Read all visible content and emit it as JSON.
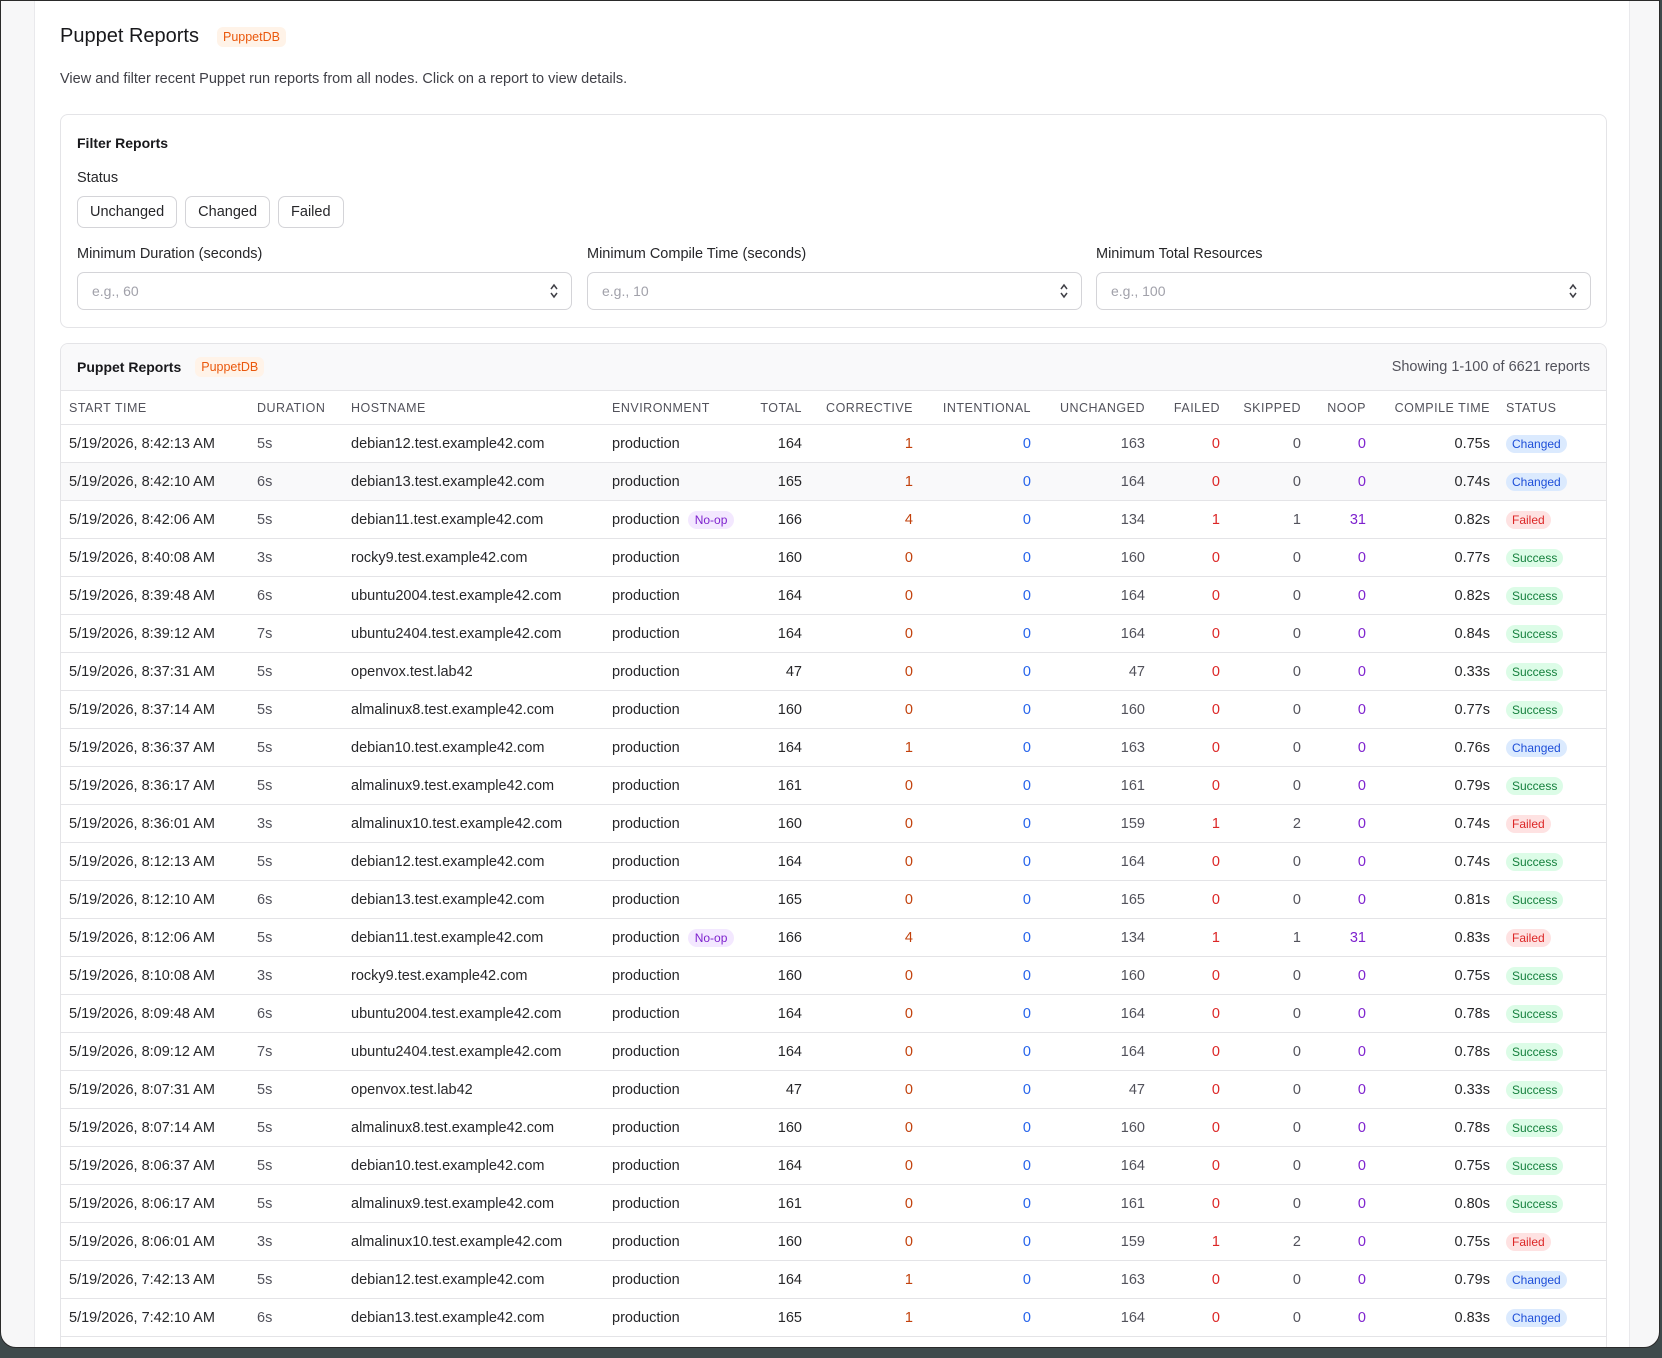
{
  "page": {
    "title": "Puppet Reports",
    "badge": "PuppetDB",
    "description": "View and filter recent Puppet run reports from all nodes. Click on a report to view details."
  },
  "filters": {
    "title": "Filter Reports",
    "status_label": "Status",
    "status_options": [
      "Unchanged",
      "Changed",
      "Failed"
    ],
    "min_duration": {
      "label": "Minimum Duration (seconds)",
      "placeholder": "e.g., 60"
    },
    "min_compile": {
      "label": "Minimum Compile Time (seconds)",
      "placeholder": "e.g., 10"
    },
    "min_resources": {
      "label": "Minimum Total Resources",
      "placeholder": "e.g., 100"
    }
  },
  "table": {
    "title": "Puppet Reports",
    "badge": "PuppetDB",
    "count_text": "Showing 1-100 of 6621 reports",
    "columns": [
      "START TIME",
      "DURATION",
      "HOSTNAME",
      "ENVIRONMENT",
      "TOTAL",
      "CORRECTIVE",
      "INTENTIONAL",
      "UNCHANGED",
      "FAILED",
      "SKIPPED",
      "NOOP",
      "COMPILE TIME",
      "STATUS"
    ],
    "rows": [
      {
        "start": "5/19/2026, 8:42:13 AM",
        "duration": "5s",
        "host": "debian12.test.example42.com",
        "env": "production",
        "noop_tag": "",
        "total": "164",
        "corrective": "1",
        "intentional": "0",
        "unchanged": "163",
        "failed": "0",
        "skipped": "0",
        "noop": "0",
        "compile": "0.75s",
        "status": "Changed"
      },
      {
        "start": "5/19/2026, 8:42:10 AM",
        "duration": "6s",
        "host": "debian13.test.example42.com",
        "env": "production",
        "noop_tag": "",
        "total": "165",
        "corrective": "1",
        "intentional": "0",
        "unchanged": "164",
        "failed": "0",
        "skipped": "0",
        "noop": "0",
        "compile": "0.74s",
        "status": "Changed"
      },
      {
        "start": "5/19/2026, 8:42:06 AM",
        "duration": "5s",
        "host": "debian11.test.example42.com",
        "env": "production",
        "noop_tag": "No-op",
        "total": "166",
        "corrective": "4",
        "intentional": "0",
        "unchanged": "134",
        "failed": "1",
        "skipped": "1",
        "noop": "31",
        "compile": "0.82s",
        "status": "Failed"
      },
      {
        "start": "5/19/2026, 8:40:08 AM",
        "duration": "3s",
        "host": "rocky9.test.example42.com",
        "env": "production",
        "noop_tag": "",
        "total": "160",
        "corrective": "0",
        "intentional": "0",
        "unchanged": "160",
        "failed": "0",
        "skipped": "0",
        "noop": "0",
        "compile": "0.77s",
        "status": "Success"
      },
      {
        "start": "5/19/2026, 8:39:48 AM",
        "duration": "6s",
        "host": "ubuntu2004.test.example42.com",
        "env": "production",
        "noop_tag": "",
        "total": "164",
        "corrective": "0",
        "intentional": "0",
        "unchanged": "164",
        "failed": "0",
        "skipped": "0",
        "noop": "0",
        "compile": "0.82s",
        "status": "Success"
      },
      {
        "start": "5/19/2026, 8:39:12 AM",
        "duration": "7s",
        "host": "ubuntu2404.test.example42.com",
        "env": "production",
        "noop_tag": "",
        "total": "164",
        "corrective": "0",
        "intentional": "0",
        "unchanged": "164",
        "failed": "0",
        "skipped": "0",
        "noop": "0",
        "compile": "0.84s",
        "status": "Success"
      },
      {
        "start": "5/19/2026, 8:37:31 AM",
        "duration": "5s",
        "host": "openvox.test.lab42",
        "env": "production",
        "noop_tag": "",
        "total": "47",
        "corrective": "0",
        "intentional": "0",
        "unchanged": "47",
        "failed": "0",
        "skipped": "0",
        "noop": "0",
        "compile": "0.33s",
        "status": "Success"
      },
      {
        "start": "5/19/2026, 8:37:14 AM",
        "duration": "5s",
        "host": "almalinux8.test.example42.com",
        "env": "production",
        "noop_tag": "",
        "total": "160",
        "corrective": "0",
        "intentional": "0",
        "unchanged": "160",
        "failed": "0",
        "skipped": "0",
        "noop": "0",
        "compile": "0.77s",
        "status": "Success"
      },
      {
        "start": "5/19/2026, 8:36:37 AM",
        "duration": "5s",
        "host": "debian10.test.example42.com",
        "env": "production",
        "noop_tag": "",
        "total": "164",
        "corrective": "1",
        "intentional": "0",
        "unchanged": "163",
        "failed": "0",
        "skipped": "0",
        "noop": "0",
        "compile": "0.76s",
        "status": "Changed"
      },
      {
        "start": "5/19/2026, 8:36:17 AM",
        "duration": "5s",
        "host": "almalinux9.test.example42.com",
        "env": "production",
        "noop_tag": "",
        "total": "161",
        "corrective": "0",
        "intentional": "0",
        "unchanged": "161",
        "failed": "0",
        "skipped": "0",
        "noop": "0",
        "compile": "0.79s",
        "status": "Success"
      },
      {
        "start": "5/19/2026, 8:36:01 AM",
        "duration": "3s",
        "host": "almalinux10.test.example42.com",
        "env": "production",
        "noop_tag": "",
        "total": "160",
        "corrective": "0",
        "intentional": "0",
        "unchanged": "159",
        "failed": "1",
        "skipped": "2",
        "noop": "0",
        "compile": "0.74s",
        "status": "Failed"
      },
      {
        "start": "5/19/2026, 8:12:13 AM",
        "duration": "5s",
        "host": "debian12.test.example42.com",
        "env": "production",
        "noop_tag": "",
        "total": "164",
        "corrective": "0",
        "intentional": "0",
        "unchanged": "164",
        "failed": "0",
        "skipped": "0",
        "noop": "0",
        "compile": "0.74s",
        "status": "Success"
      },
      {
        "start": "5/19/2026, 8:12:10 AM",
        "duration": "6s",
        "host": "debian13.test.example42.com",
        "env": "production",
        "noop_tag": "",
        "total": "165",
        "corrective": "0",
        "intentional": "0",
        "unchanged": "165",
        "failed": "0",
        "skipped": "0",
        "noop": "0",
        "compile": "0.81s",
        "status": "Success"
      },
      {
        "start": "5/19/2026, 8:12:06 AM",
        "duration": "5s",
        "host": "debian11.test.example42.com",
        "env": "production",
        "noop_tag": "No-op",
        "total": "166",
        "corrective": "4",
        "intentional": "0",
        "unchanged": "134",
        "failed": "1",
        "skipped": "1",
        "noop": "31",
        "compile": "0.83s",
        "status": "Failed"
      },
      {
        "start": "5/19/2026, 8:10:08 AM",
        "duration": "3s",
        "host": "rocky9.test.example42.com",
        "env": "production",
        "noop_tag": "",
        "total": "160",
        "corrective": "0",
        "intentional": "0",
        "unchanged": "160",
        "failed": "0",
        "skipped": "0",
        "noop": "0",
        "compile": "0.75s",
        "status": "Success"
      },
      {
        "start": "5/19/2026, 8:09:48 AM",
        "duration": "6s",
        "host": "ubuntu2004.test.example42.com",
        "env": "production",
        "noop_tag": "",
        "total": "164",
        "corrective": "0",
        "intentional": "0",
        "unchanged": "164",
        "failed": "0",
        "skipped": "0",
        "noop": "0",
        "compile": "0.78s",
        "status": "Success"
      },
      {
        "start": "5/19/2026, 8:09:12 AM",
        "duration": "7s",
        "host": "ubuntu2404.test.example42.com",
        "env": "production",
        "noop_tag": "",
        "total": "164",
        "corrective": "0",
        "intentional": "0",
        "unchanged": "164",
        "failed": "0",
        "skipped": "0",
        "noop": "0",
        "compile": "0.78s",
        "status": "Success"
      },
      {
        "start": "5/19/2026, 8:07:31 AM",
        "duration": "5s",
        "host": "openvox.test.lab42",
        "env": "production",
        "noop_tag": "",
        "total": "47",
        "corrective": "0",
        "intentional": "0",
        "unchanged": "47",
        "failed": "0",
        "skipped": "0",
        "noop": "0",
        "compile": "0.33s",
        "status": "Success"
      },
      {
        "start": "5/19/2026, 8:07:14 AM",
        "duration": "5s",
        "host": "almalinux8.test.example42.com",
        "env": "production",
        "noop_tag": "",
        "total": "160",
        "corrective": "0",
        "intentional": "0",
        "unchanged": "160",
        "failed": "0",
        "skipped": "0",
        "noop": "0",
        "compile": "0.78s",
        "status": "Success"
      },
      {
        "start": "5/19/2026, 8:06:37 AM",
        "duration": "5s",
        "host": "debian10.test.example42.com",
        "env": "production",
        "noop_tag": "",
        "total": "164",
        "corrective": "0",
        "intentional": "0",
        "unchanged": "164",
        "failed": "0",
        "skipped": "0",
        "noop": "0",
        "compile": "0.75s",
        "status": "Success"
      },
      {
        "start": "5/19/2026, 8:06:17 AM",
        "duration": "5s",
        "host": "almalinux9.test.example42.com",
        "env": "production",
        "noop_tag": "",
        "total": "161",
        "corrective": "0",
        "intentional": "0",
        "unchanged": "161",
        "failed": "0",
        "skipped": "0",
        "noop": "0",
        "compile": "0.80s",
        "status": "Success"
      },
      {
        "start": "5/19/2026, 8:06:01 AM",
        "duration": "3s",
        "host": "almalinux10.test.example42.com",
        "env": "production",
        "noop_tag": "",
        "total": "160",
        "corrective": "0",
        "intentional": "0",
        "unchanged": "159",
        "failed": "1",
        "skipped": "2",
        "noop": "0",
        "compile": "0.75s",
        "status": "Failed"
      },
      {
        "start": "5/19/2026, 7:42:13 AM",
        "duration": "5s",
        "host": "debian12.test.example42.com",
        "env": "production",
        "noop_tag": "",
        "total": "164",
        "corrective": "1",
        "intentional": "0",
        "unchanged": "163",
        "failed": "0",
        "skipped": "0",
        "noop": "0",
        "compile": "0.79s",
        "status": "Changed"
      },
      {
        "start": "5/19/2026, 7:42:10 AM",
        "duration": "6s",
        "host": "debian13.test.example42.com",
        "env": "production",
        "noop_tag": "",
        "total": "165",
        "corrective": "1",
        "intentional": "0",
        "unchanged": "164",
        "failed": "0",
        "skipped": "0",
        "noop": "0",
        "compile": "0.83s",
        "status": "Changed"
      }
    ]
  },
  "colors": {
    "badge_orange": "#ea580c",
    "corrective": "#c2410c",
    "intentional": "#2563eb",
    "failed": "#dc2626",
    "noop": "#7e22ce",
    "status_changed": "#1d4ed8",
    "status_failed": "#dc2626",
    "status_success": "#15803d"
  },
  "icons": {
    "stepper": "up-down-chevron-icon"
  }
}
